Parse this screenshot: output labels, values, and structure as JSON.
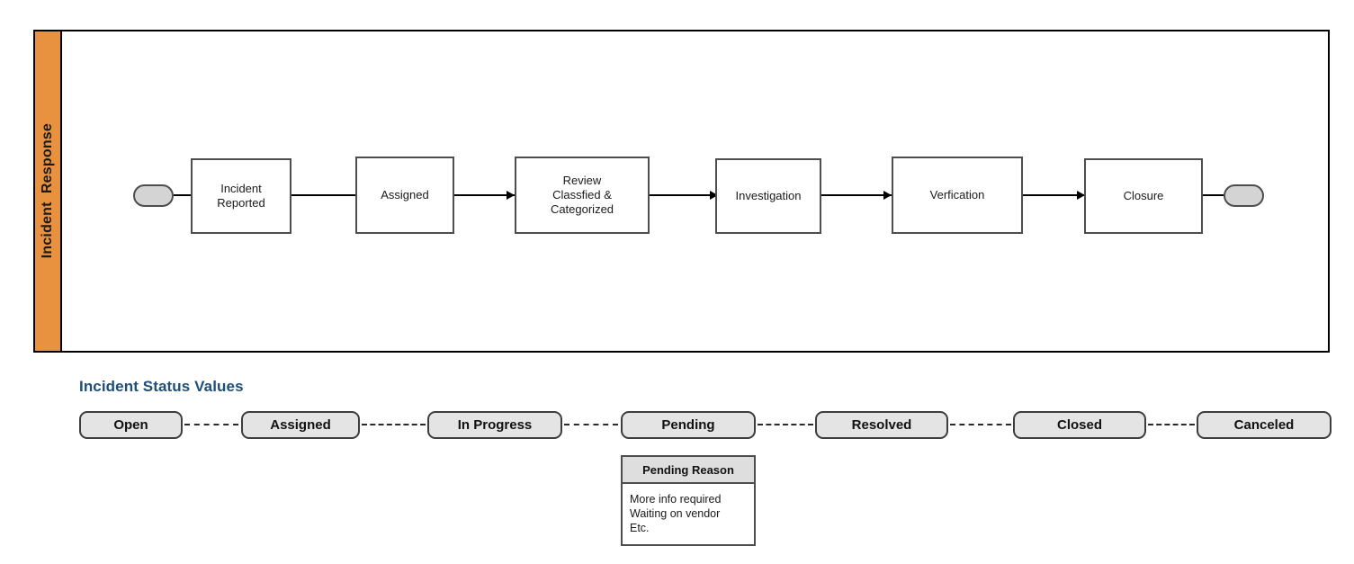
{
  "diagram": {
    "lane": {
      "label": "Incident  Response"
    },
    "start_marker": "start-terminator",
    "end_marker": "end-terminator",
    "nodes": [
      {
        "id": "incident-reported",
        "label": "Incident\nReported"
      },
      {
        "id": "assigned",
        "label": "Assigned"
      },
      {
        "id": "review",
        "label": "Review\nClassfied &\nCategorized"
      },
      {
        "id": "investigation",
        "label": "Investigation"
      },
      {
        "id": "verification",
        "label": "Verfication"
      },
      {
        "id": "closure",
        "label": "Closure"
      }
    ]
  },
  "status": {
    "title": "Incident Status Values",
    "values": [
      {
        "label": "Open"
      },
      {
        "label": "Assigned"
      },
      {
        "label": "In Progress"
      },
      {
        "label": "Pending"
      },
      {
        "label": "Resolved"
      },
      {
        "label": "Closed"
      },
      {
        "label": "Canceled"
      }
    ]
  },
  "pending_reason": {
    "header": "Pending Reason",
    "items": [
      "More info required",
      "Waiting on vendor",
      "Etc."
    ]
  },
  "colors": {
    "lane_accent": "#E8923F",
    "title_blue": "#1F4E79",
    "pill_fill": "#E4E4E4",
    "terminator_fill": "#D4D4D4",
    "node_border": "#4D4D4D"
  }
}
